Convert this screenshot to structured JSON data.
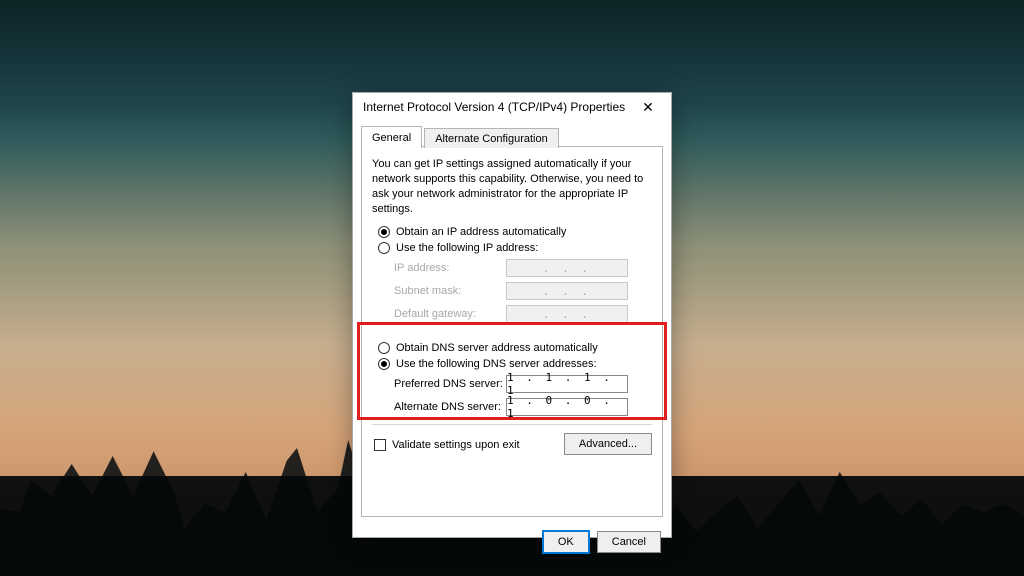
{
  "window": {
    "title": "Internet Protocol Version 4 (TCP/IPv4) Properties",
    "close_glyph": "✕"
  },
  "tabs": {
    "general": "General",
    "alt": "Alternate Configuration"
  },
  "description": "You can get IP settings assigned automatically if your network supports this capability. Otherwise, you need to ask your network administrator for the appropriate IP settings.",
  "ip_section": {
    "auto": "Obtain an IP address automatically",
    "manual": "Use the following IP address:",
    "ip_label": "IP address:",
    "mask_label": "Subnet mask:",
    "gateway_label": "Default gateway:",
    "dots": ".   .   ."
  },
  "dns_section": {
    "auto": "Obtain DNS server address automatically",
    "manual": "Use the following DNS server addresses:",
    "preferred_label": "Preferred DNS server:",
    "alternate_label": "Alternate DNS server:",
    "preferred_value": "1 . 1 . 1 . 1",
    "alternate_value": "1 . 0 . 0 . 1"
  },
  "validate_label": "Validate settings upon exit",
  "advanced_label": "Advanced...",
  "buttons": {
    "ok": "OK",
    "cancel": "Cancel"
  }
}
